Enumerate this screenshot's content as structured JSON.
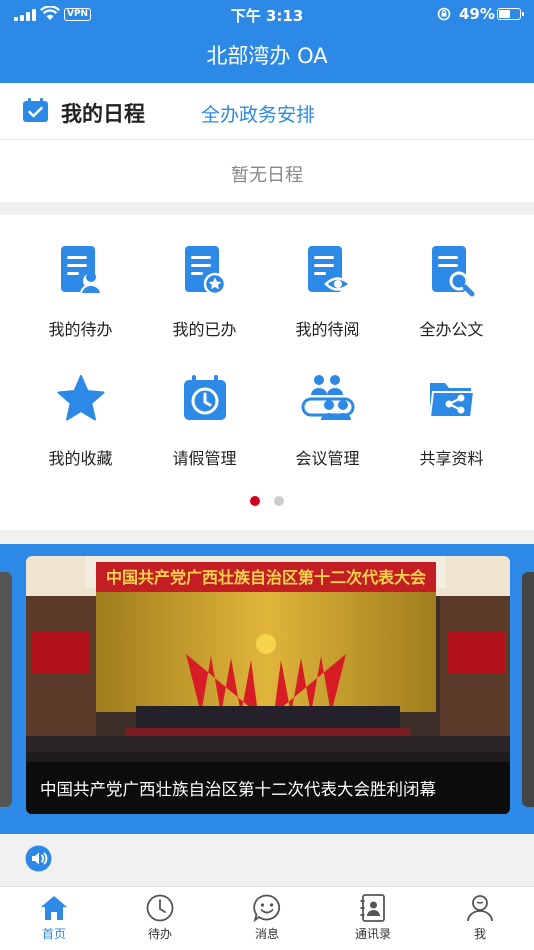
{
  "status_bar": {
    "time": "下午 3:13",
    "vpn": "VPN",
    "battery_percent": "49%",
    "battery_level": 0.49
  },
  "app": {
    "title": "北部湾办 OA"
  },
  "schedule": {
    "title": "我的日程",
    "tab_label": "全办政务安排",
    "empty_text": "暂无日程"
  },
  "grid": {
    "items": [
      {
        "label": "我的待办",
        "icon": "todo-doc-user-icon"
      },
      {
        "label": "我的已办",
        "icon": "done-doc-star-icon"
      },
      {
        "label": "我的待阅",
        "icon": "toread-doc-eye-icon"
      },
      {
        "label": "全办公文",
        "icon": "doc-search-icon"
      },
      {
        "label": "我的收藏",
        "icon": "star-icon"
      },
      {
        "label": "请假管理",
        "icon": "calendar-clock-icon"
      },
      {
        "label": "会议管理",
        "icon": "meeting-people-icon"
      },
      {
        "label": "共享资料",
        "icon": "shared-folder-icon"
      }
    ],
    "page_indicator": {
      "pages": 2,
      "current": 1
    }
  },
  "banner": {
    "caption": "中国共产党广西壮族自治区第十二次代表大会胜利闭幕",
    "stage_text": "中国共产党广西壮族自治区第十二次代表大会"
  },
  "tabbar": {
    "items": [
      {
        "label": "首页",
        "icon": "home-icon",
        "active": true
      },
      {
        "label": "待办",
        "icon": "clock-icon",
        "active": false
      },
      {
        "label": "消息",
        "icon": "message-smile-icon",
        "active": false
      },
      {
        "label": "通讯录",
        "icon": "contacts-icon",
        "active": false
      },
      {
        "label": "我",
        "icon": "person-icon",
        "active": false
      }
    ]
  },
  "colors": {
    "primary": "#2c8ae6",
    "indicator_active": "#d0021b",
    "stage_red": "#b3121b"
  }
}
